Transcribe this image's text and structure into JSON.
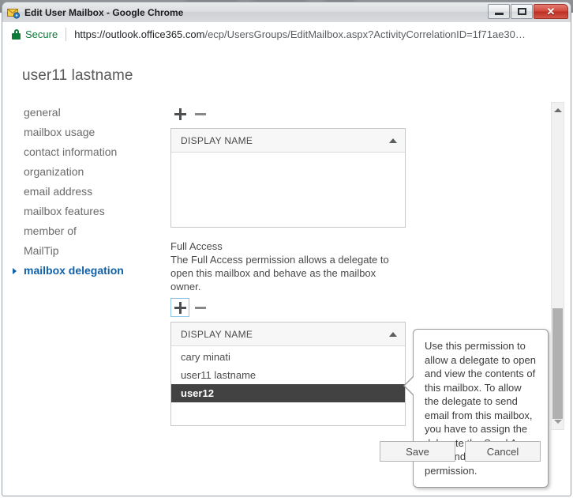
{
  "window": {
    "title": "Edit User Mailbox - Google Chrome",
    "icon": "mail-envelope-icon",
    "controls": {
      "minimize": "minimize-button",
      "maximize": "maximize-button",
      "close": "✕"
    }
  },
  "omnibox": {
    "security_label": "Secure",
    "security_icon": "lock-icon",
    "url_host": "https://outlook.office365.com",
    "url_path": "/ecp/UsersGroups/EditMailbox.aspx?ActivityCorrelationID=1f71ae30…"
  },
  "page": {
    "title": "user11 lastname"
  },
  "nav": {
    "items": [
      {
        "label": "general",
        "selected": false
      },
      {
        "label": "mailbox usage",
        "selected": false
      },
      {
        "label": "contact information",
        "selected": false
      },
      {
        "label": "organization",
        "selected": false
      },
      {
        "label": "email address",
        "selected": false
      },
      {
        "label": "mailbox features",
        "selected": false
      },
      {
        "label": "member of",
        "selected": false
      },
      {
        "label": "MailTip",
        "selected": false
      },
      {
        "label": "mailbox delegation",
        "selected": true
      }
    ]
  },
  "toolbar_top": {
    "add_label": "+",
    "remove_label": "−"
  },
  "grid_top": {
    "header": "DISPLAY NAME",
    "sort": "ascending",
    "rows": []
  },
  "full_access": {
    "label": "Full Access",
    "description": "The Full Access permission allows a delegate to open this mailbox and behave as the mailbox owner.",
    "add_label": "+",
    "remove_label": "−"
  },
  "grid_bottom": {
    "header": "DISPLAY NAME",
    "sort": "ascending",
    "rows": [
      {
        "name": "cary minati",
        "selected": false
      },
      {
        "name": "user11 lastname",
        "selected": false
      },
      {
        "name": "user12",
        "selected": true
      }
    ]
  },
  "tooltip": {
    "text": "Use this permission to allow a delegate to open and view the contents of this mailbox. To allow the delegate to send email from this mailbox, you have to assign the delegate the Send As or the Send on Behalf Of permission."
  },
  "footer": {
    "save_label": "Save",
    "cancel_label": "Cancel"
  },
  "colors": {
    "accent": "#1060a8",
    "selection": "#424242",
    "secure": "#0b7b37",
    "close_button": "#bc2e22"
  }
}
